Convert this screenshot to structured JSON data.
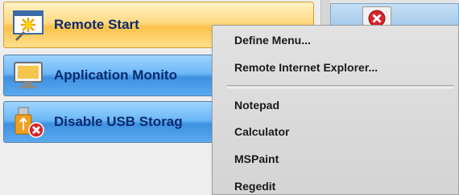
{
  "sidebar": {
    "items": [
      {
        "label": "Remote Start",
        "icon": "remote-start-icon"
      },
      {
        "label": "Application Monito",
        "icon": "monitor-icon"
      },
      {
        "label": "Disable USB Storag",
        "icon": "usb-disable-icon"
      }
    ]
  },
  "context_menu": {
    "items": [
      {
        "label": "Define Menu..."
      },
      {
        "label": "Remote Internet Explorer..."
      },
      {
        "label": "Notepad"
      },
      {
        "label": "Calculator"
      },
      {
        "label": "MSPaint"
      },
      {
        "label": "Regedit"
      }
    ]
  },
  "colors": {
    "active_button": "#fcc24a",
    "button_blue": "#4a9be6",
    "label_text": "#0c2a6e",
    "close_red": "#d9232a"
  }
}
